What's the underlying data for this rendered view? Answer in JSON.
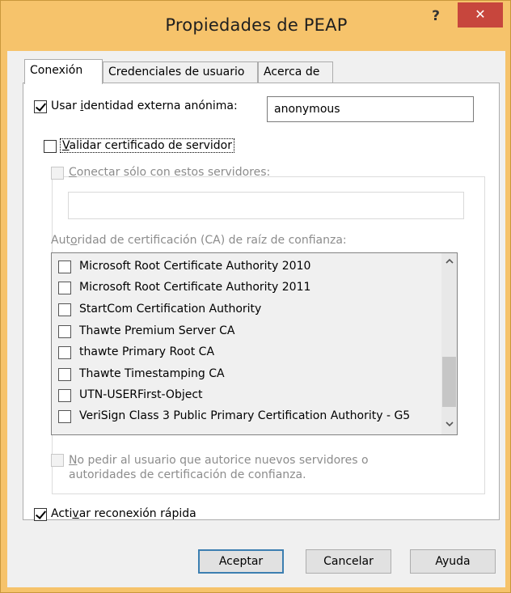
{
  "window": {
    "title": "Propiedades de PEAP",
    "help_label": "?",
    "close_label": "✕"
  },
  "tabs": [
    {
      "label": "Conexión",
      "active": true
    },
    {
      "label": "Credenciales de usuario",
      "active": false
    },
    {
      "label": "Acerca de",
      "active": false
    }
  ],
  "anon_identity": {
    "label_pre": "Usar ",
    "label_access": "i",
    "label_post": "dentidad externa anónima:",
    "checked": true,
    "value": "anonymous"
  },
  "validate_cert": {
    "label_access": "V",
    "label_post": "alidar certificado de servidor",
    "checked": false
  },
  "connect_servers": {
    "label_access": "C",
    "label_post": "onectar sólo con estos servidores:",
    "checked": false,
    "value": ""
  },
  "trusted_ca": {
    "label_pre": "Aut",
    "label_access": "o",
    "label_post": "ridad de certificación (CA) de raíz de confianza:"
  },
  "ca_list": [
    "Microsoft Root Certificate Authority 2010",
    "Microsoft Root Certificate Authority 2011",
    "StartCom Certification Authority",
    "Thawte Premium Server CA",
    "thawte Primary Root CA",
    "Thawte Timestamping CA",
    "UTN-USERFirst-Object",
    "VeriSign Class 3 Public Primary Certification Authority - G5"
  ],
  "no_prompt": {
    "label_access": "N",
    "line1_post": "o pedir al usuario que autorice nuevos servidores o",
    "line2": "autoridades de certificación de confianza.",
    "checked": false
  },
  "fast_reconnect": {
    "label_pre": "Acti",
    "label_access": "v",
    "label_post": "ar reconexión rápida",
    "checked": true
  },
  "buttons": {
    "ok": "Aceptar",
    "cancel": "Cancelar",
    "help": "Ayuda"
  },
  "colors": {
    "title_bar": "#f6c36b",
    "close_button": "#c7463d",
    "dialog_bg": "#f0f0f0",
    "default_button_border": "#3c7fb1"
  },
  "icons": {
    "scroll_up": "chevron-up-icon",
    "scroll_down": "chevron-down-icon"
  }
}
